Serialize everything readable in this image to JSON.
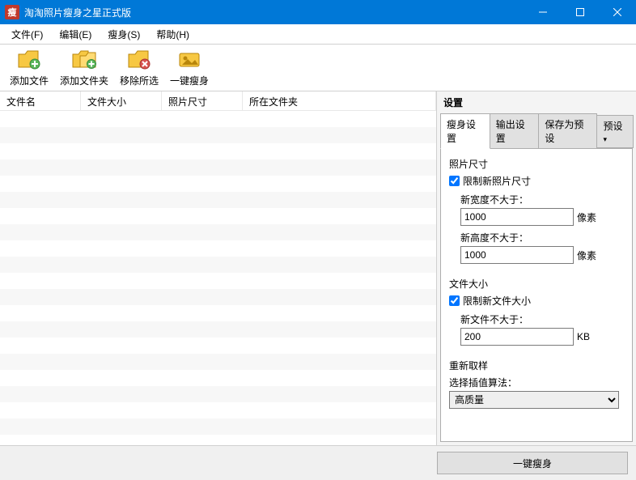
{
  "title": "淘淘照片瘦身之星正式版",
  "menu": {
    "file": "文件(F)",
    "edit": "编辑(E)",
    "slim": "瘦身(S)",
    "help": "帮助(H)"
  },
  "toolbar": {
    "add_file": "添加文件",
    "add_folder": "添加文件夹",
    "remove_sel": "移除所选",
    "one_click": "一键瘦身"
  },
  "columns": {
    "filename": "文件名",
    "filesize": "文件大小",
    "photosize": "照片尺寸",
    "folder": "所在文件夹"
  },
  "settings": {
    "title": "设置",
    "tabs": {
      "slim": "瘦身设置",
      "output": "输出设置",
      "save_preset": "保存为预设",
      "preset": "预设"
    },
    "photo_size": {
      "title": "照片尺寸",
      "limit_label": "限制新照片尺寸",
      "width_label": "新宽度不大于：",
      "width_value": "1000",
      "height_label": "新高度不大于：",
      "height_value": "1000",
      "unit": "像素"
    },
    "file_size": {
      "title": "文件大小",
      "limit_label": "限制新文件大小",
      "size_label": "新文件不大于：",
      "size_value": "200",
      "unit": "KB"
    },
    "resample": {
      "title": "重新取样",
      "algo_label": "选择插值算法：",
      "algo_value": "高质量"
    }
  },
  "footer": {
    "run": "一键瘦身"
  }
}
